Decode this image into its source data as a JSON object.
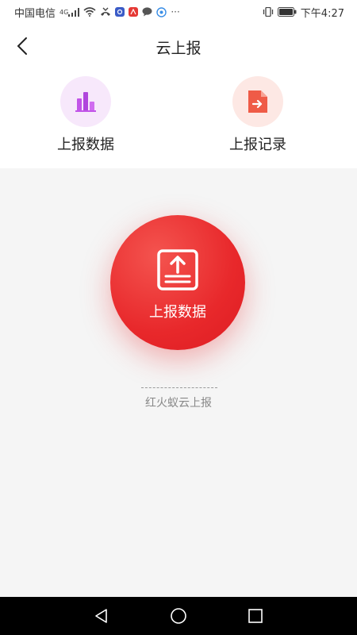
{
  "status_bar": {
    "carrier": "中国电信",
    "network": "4G",
    "time": "下午4:27",
    "more": "···"
  },
  "nav": {
    "title": "云上报"
  },
  "features": [
    {
      "label": "上报数据",
      "icon": "bar-chart-icon",
      "color": "#c254e8",
      "bg": "#f7e8fb"
    },
    {
      "label": "上报记录",
      "icon": "document-arrow-icon",
      "color": "#ef5b47",
      "bg": "#fde8e4"
    }
  ],
  "main": {
    "upload_label": "上报数据",
    "footer_brand": "红火蚁云上报"
  },
  "colors": {
    "accent": "#e8282b",
    "page_background": "#f5f5f5"
  }
}
